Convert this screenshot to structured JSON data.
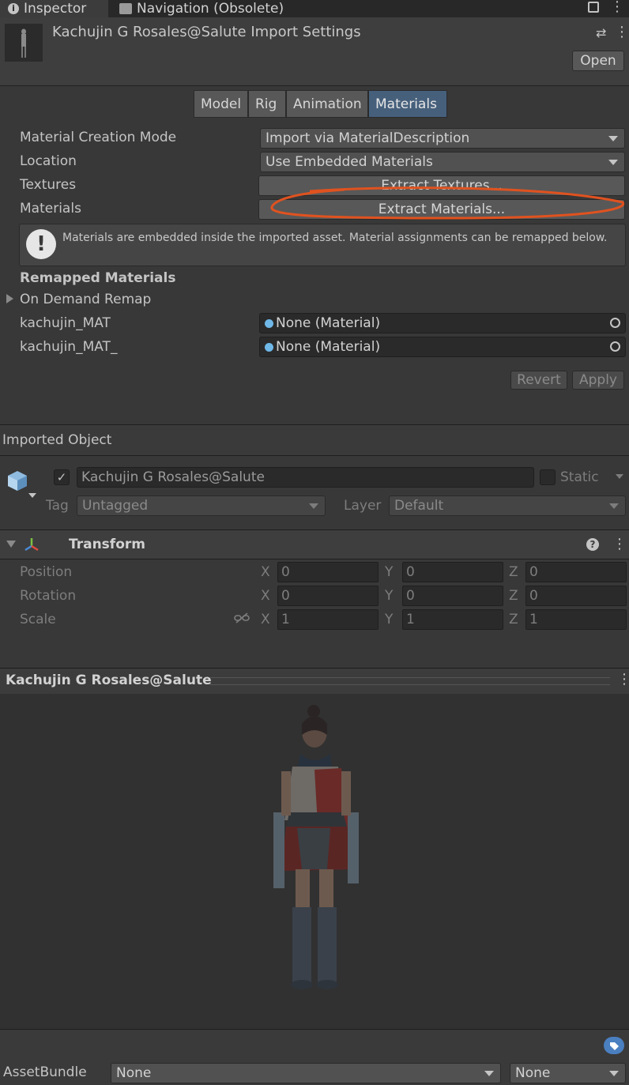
{
  "tabs": {
    "inspector": "Inspector",
    "navigation": "Navigation (Obsolete)"
  },
  "header": {
    "title": "Kachujin G Rosales@Salute Import Settings",
    "open_label": "Open"
  },
  "import_tabs": [
    "Model",
    "Rig",
    "Animation",
    "Materials"
  ],
  "materials": {
    "creation_mode_label": "Material Creation Mode",
    "creation_mode_value": "Import via MaterialDescription",
    "location_label": "Location",
    "location_value": "Use Embedded Materials",
    "textures_label": "Textures",
    "extract_textures_label": "Extract Textures...",
    "materials_label": "Materials",
    "extract_materials_label": "Extract Materials...",
    "help_text": "Materials are embedded inside the imported asset. Material assignments can be remapped below.",
    "remapped_heading": "Remapped Materials",
    "on_demand_label": "On Demand Remap",
    "slots": [
      {
        "name": "kachujin_MAT",
        "value": "None (Material)"
      },
      {
        "name": "kachujin_MAT_",
        "value": "None (Material)"
      }
    ],
    "revert_label": "Revert",
    "apply_label": "Apply"
  },
  "imported_object": {
    "heading": "Imported Object",
    "name": "Kachujin G Rosales@Salute",
    "static_label": "Static",
    "tag_label": "Tag",
    "tag_value": "Untagged",
    "layer_label": "Layer",
    "layer_value": "Default"
  },
  "transform": {
    "title": "Transform",
    "rows": [
      {
        "label": "Position",
        "x": "0",
        "y": "0",
        "z": "0"
      },
      {
        "label": "Rotation",
        "x": "0",
        "y": "0",
        "z": "0"
      },
      {
        "label": "Scale",
        "x": "1",
        "y": "1",
        "z": "1"
      }
    ],
    "axis_labels": {
      "x": "X",
      "y": "Y",
      "z": "Z"
    }
  },
  "preview": {
    "title": "Kachujin G Rosales@Salute"
  },
  "asset_bundle": {
    "label": "AssetBundle",
    "name_value": "None",
    "variant_value": "None"
  },
  "colors": {
    "selected_tab": "#46607c",
    "annotation": "#e0521f",
    "background": "#383838"
  }
}
